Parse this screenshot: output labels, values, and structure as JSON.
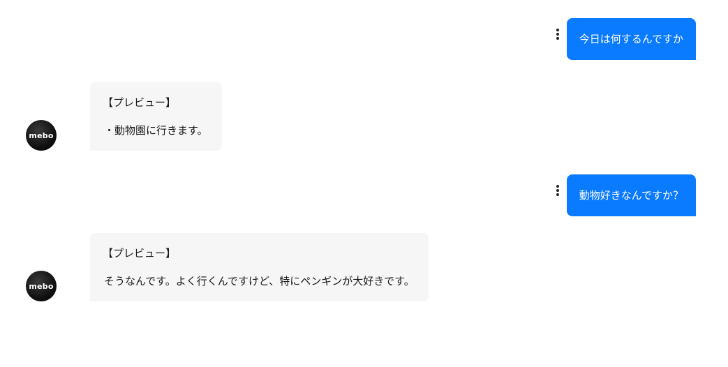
{
  "messages": [
    {
      "role": "user",
      "text": "今日は何するんですか"
    },
    {
      "role": "bot",
      "avatar_label": "mebo",
      "heading": "【プレビュー】",
      "body": "・動物園に行きます。"
    },
    {
      "role": "user",
      "text": "動物好きなんですか？"
    },
    {
      "role": "bot",
      "avatar_label": "mebo",
      "heading": "【プレビュー】",
      "body": "そうなんです。よく行くんですけど、特にペンギンが大好きです。"
    }
  ],
  "colors": {
    "user_bubble": "#0a7aff",
    "bot_bubble": "#f5f6f5",
    "avatar_bg": "#111111"
  },
  "icons": {
    "message_menu": "more-vertical-icon"
  }
}
